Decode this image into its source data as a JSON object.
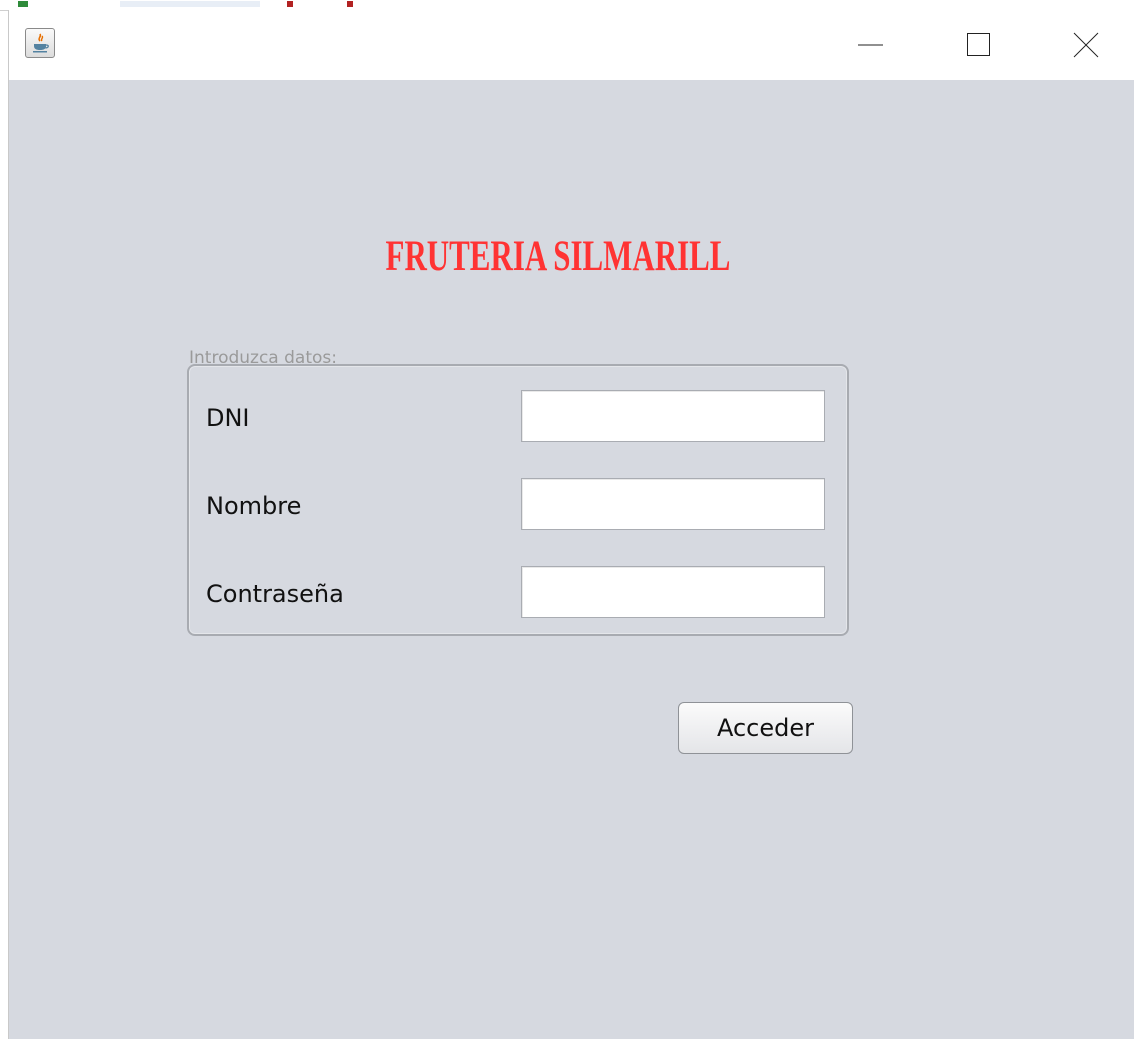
{
  "window": {
    "title": "",
    "controls": {
      "minimize_icon": "minimize-icon",
      "maximize_icon": "maximize-icon",
      "close_icon": "close-icon"
    },
    "app_icon": "java-icon"
  },
  "brand": {
    "title": "FRUTERIA SILMARILL",
    "color": "#ff3333"
  },
  "form": {
    "caption": "Introduzca datos:",
    "fields": [
      {
        "label": "DNI",
        "value": "",
        "placeholder": ""
      },
      {
        "label": "Nombre",
        "value": "",
        "placeholder": ""
      },
      {
        "label": "Contraseña",
        "value": "",
        "placeholder": ""
      }
    ],
    "submit_label": "Acceder"
  },
  "colors": {
    "background": "#d6d9e0",
    "titlebar": "#ffffff"
  }
}
